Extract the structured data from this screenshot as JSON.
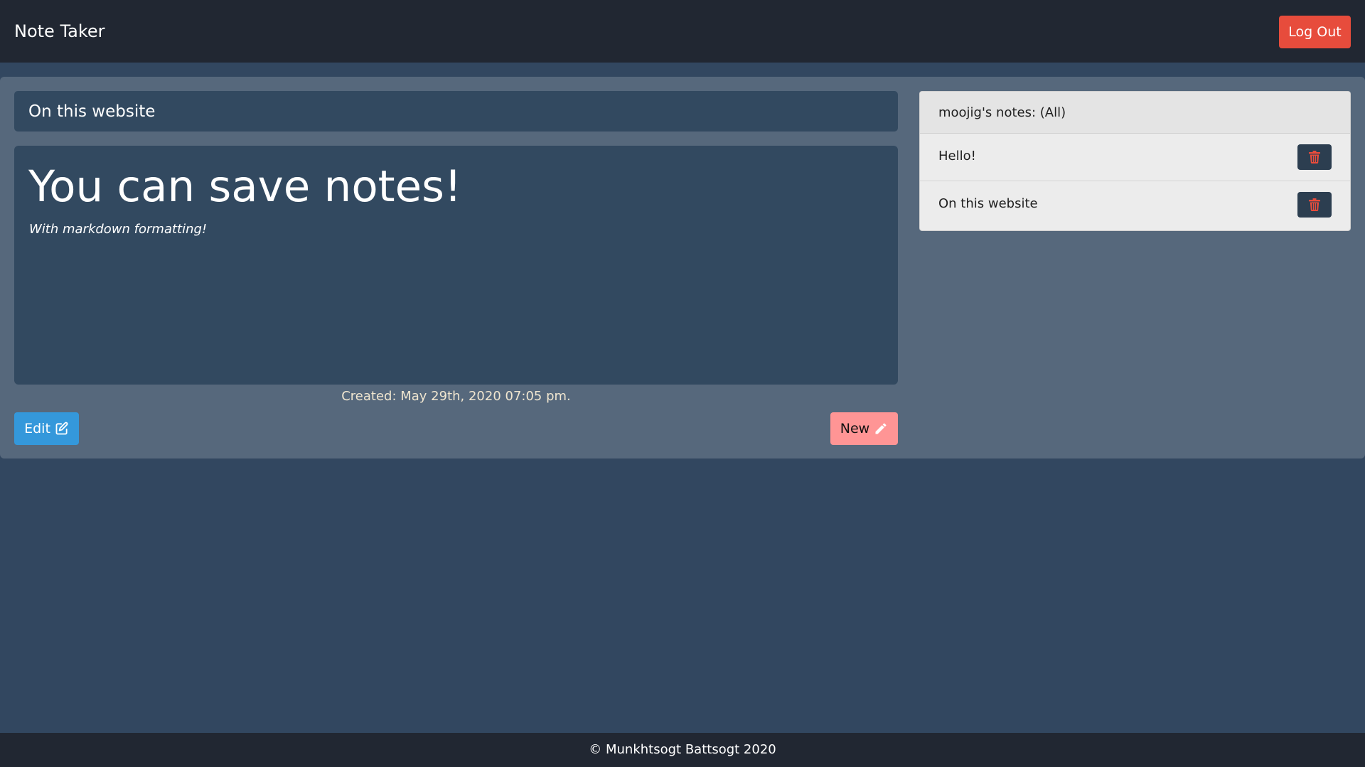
{
  "navbar": {
    "brand": "Note Taker",
    "logout_label": "Log Out"
  },
  "note": {
    "title": "On this website",
    "heading": "You can save notes!",
    "subtext": "With markdown formatting!",
    "created": "Created: May 29th, 2020 07:05 pm."
  },
  "actions": {
    "edit_label": "Edit",
    "edit_icon": "edit-icon",
    "new_label": "New",
    "new_icon": "pencil-icon"
  },
  "notes_list": {
    "header": "moojig's notes: (All)",
    "items": [
      {
        "label": "Hello!",
        "delete_icon": "trash-icon"
      },
      {
        "label": "On this website",
        "delete_icon": "trash-icon"
      }
    ]
  },
  "footer": {
    "text": "© Munkhtsogt Battsogt 2020"
  },
  "colors": {
    "page_bg": "#324760",
    "navbar_bg": "#212732",
    "card_bg": "#56687c",
    "panel_bg": "#324960",
    "logout": "#e74c3c",
    "edit": "#3498db",
    "new": "#ff9595",
    "delete_bg": "#2c3e50",
    "trash": "#e74c3c"
  }
}
